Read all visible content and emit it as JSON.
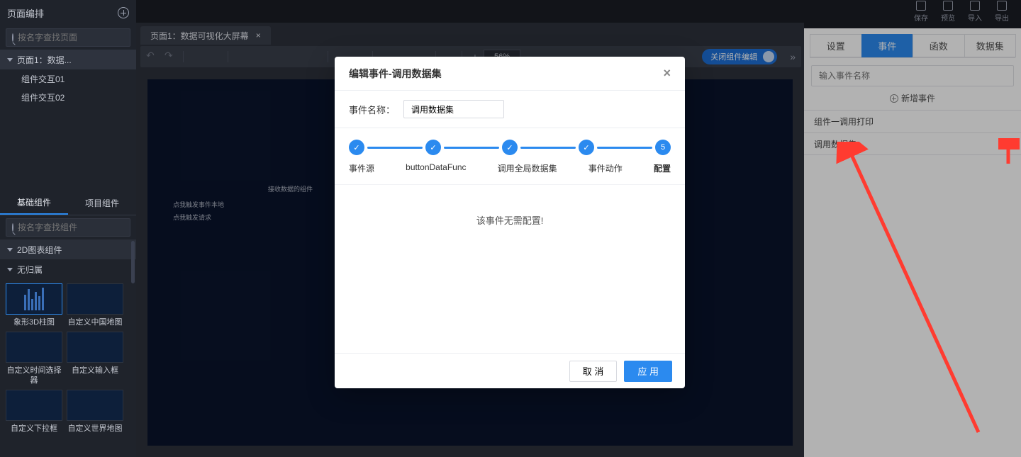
{
  "topbar": {
    "save": "保存",
    "preview": "预览",
    "import": "导入",
    "export": "导出"
  },
  "sidebar": {
    "title": "页面编排",
    "search_placeholder": "按名字查找页面",
    "tree": {
      "page_label": "页面1：数据...",
      "children": [
        "组件交互01",
        "组件交互02"
      ]
    },
    "comp_tabs": {
      "basic": "基础组件",
      "project": "项目组件"
    },
    "comp_search_placeholder": "按名字查找组件",
    "group_2d": "2D图表组件",
    "group_unowned": "无归属",
    "cells": [
      {
        "label": "象形3D柱图"
      },
      {
        "label": "自定义中国地图"
      },
      {
        "label": "自定义时间选择器"
      },
      {
        "label": "自定义输入框"
      },
      {
        "label": "自定义下拉框"
      },
      {
        "label": "自定义世界地图"
      }
    ]
  },
  "center": {
    "tab_title": "页面1：数据可视化大屏幕",
    "zoom": "56%",
    "toolbar_toggle": "关闭组件编辑",
    "stage_texts": {
      "widget": "接收数据的组件",
      "l1": "点我触发事件本地",
      "l2": "点我触发请求"
    }
  },
  "right": {
    "tabs": {
      "settings": "设置",
      "events": "事件",
      "funcs": "函数",
      "datasets": "数据集"
    },
    "search_placeholder": "输入事件名称",
    "add_event": "新增事件",
    "items": [
      "组件一调用打印",
      "调用数据集"
    ]
  },
  "modal": {
    "title": "编辑事件-调用数据集",
    "field_label": "事件名称：",
    "field_value": "调用数据集",
    "steps": [
      "事件源",
      "buttonDataFunc",
      "调用全局数据集",
      "事件动作",
      "配置"
    ],
    "active_step_num": "5",
    "body_text": "该事件无需配置!",
    "cancel": "取 消",
    "apply": "应 用"
  }
}
